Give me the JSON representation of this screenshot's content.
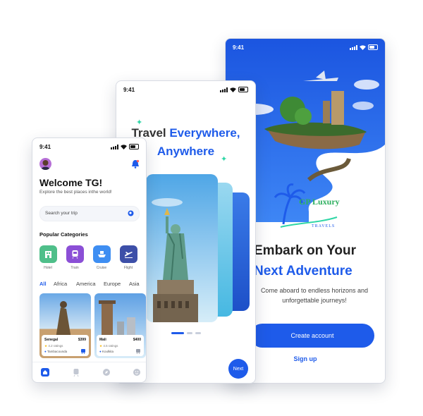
{
  "colors": {
    "accent": "#1e5bea",
    "mint": "#2fd6a6",
    "hotel": "#4fbf8a",
    "train": "#8b4fd6",
    "cruise": "#3e8ef2",
    "flight": "#3d4fa8"
  },
  "onboarding_signup": {
    "status_time": "9:41",
    "brand": {
      "main": "GP Luxury",
      "sub": "TRAVELS"
    },
    "title_line1": "Embark on Your",
    "title_line2": "Next Adventure",
    "description": "Come aboard to endless horizons and unforgettable journeys!",
    "create_account_label": "Create account",
    "signup_label": "Sign up"
  },
  "onboarding_explore": {
    "status_time": "9:41",
    "title_part1": "Travel ",
    "title_part2": "Everywhere,",
    "title_line2": "Anywhere",
    "next_label": "Next",
    "page_index": 0,
    "page_count": 3
  },
  "home": {
    "status_time": "9:41",
    "welcome": "Welcome TG!",
    "subtitle": "Explore the best places inthe world!",
    "search_placeholder": "Search your trip",
    "categories_title": "Popular Categories",
    "categories": [
      {
        "label": "Hotel",
        "icon": "hotel-icon"
      },
      {
        "label": "Train",
        "icon": "train-icon"
      },
      {
        "label": "Cruise",
        "icon": "cruise-icon"
      },
      {
        "label": "Flight",
        "icon": "flight-icon"
      }
    ],
    "region_tabs": [
      "All",
      "Africa",
      "America",
      "Europe",
      "Asia"
    ],
    "active_tab": "All",
    "places": [
      {
        "name": "Senegal",
        "price": "$399",
        "ratings": "4.2 ratings",
        "location": "Tambacounda"
      },
      {
        "name": "Mali",
        "price": "$400",
        "ratings": "4.5 ratings",
        "location": "Koulkita"
      }
    ]
  }
}
